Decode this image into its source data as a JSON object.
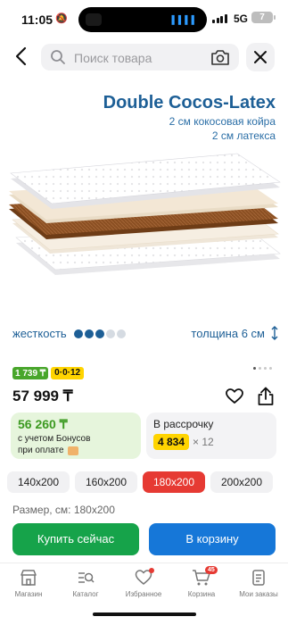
{
  "status_bar": {
    "time": "11:05",
    "network": "5G",
    "battery": "7"
  },
  "search": {
    "placeholder": "Поиск товара"
  },
  "product": {
    "title": "Double Cocos-Latex",
    "subtitle_line1": "2 см кокосовая койра",
    "subtitle_line2": "2 см латекса",
    "stiffness_label": "жесткость",
    "stiffness_level": 3,
    "stiffness_max": 5,
    "thickness_label": "толщина 6 см",
    "layer_colors": [
      "#ffffff",
      "#f3e7d5",
      "#8a4f22",
      "#f4eee6",
      "#ffffff"
    ]
  },
  "gallery": {
    "page_count": 4,
    "current_page": 1
  },
  "badges": {
    "bonus_badge": "1 739 ₸",
    "installment_badge": "0·0·12"
  },
  "price": {
    "value": "57 999 ₸"
  },
  "bonus_card": {
    "amount": "56 260 ₸",
    "line1": "с учетом Бонусов",
    "line2": "при оплате"
  },
  "installment_card": {
    "title": "В рассрочку",
    "payment": "4 834",
    "multiplier": "× 12"
  },
  "sizes": {
    "options": [
      "140x200",
      "160x200",
      "180x200",
      "200x200"
    ],
    "selected_index": 2,
    "label": "Размер, см: 180x200"
  },
  "actions": {
    "buy_now": "Купить сейчас",
    "add_to_cart": "В корзину"
  },
  "nav": {
    "items": [
      {
        "label": "Магазин",
        "icon": "store-icon"
      },
      {
        "label": "Каталог",
        "icon": "catalog-icon"
      },
      {
        "label": "Избранное",
        "icon": "heart-icon"
      },
      {
        "label": "Корзина",
        "icon": "cart-icon"
      },
      {
        "label": "Мои заказы",
        "icon": "orders-icon"
      }
    ],
    "cart_count": "45"
  },
  "colors": {
    "brand_red": "#e63a33",
    "title_blue": "#1d5f96",
    "green": "#16a34a",
    "blue": "#1677d8",
    "yellow": "#ffd400"
  }
}
